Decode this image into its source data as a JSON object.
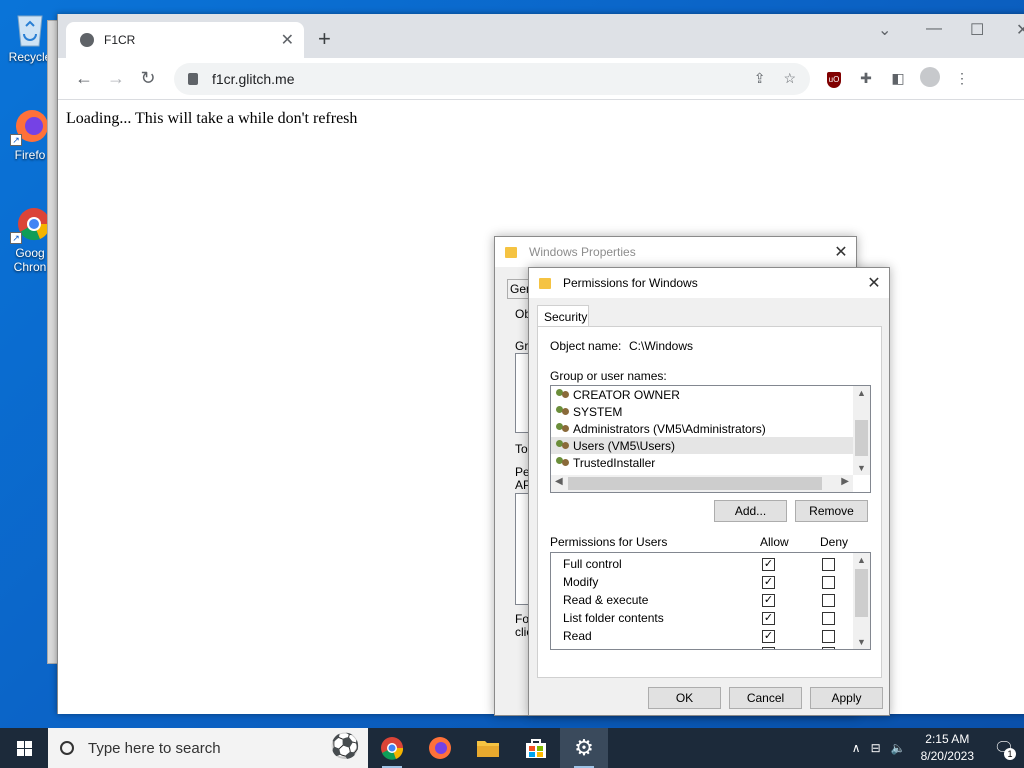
{
  "desktop": {
    "icons": [
      {
        "label": "Recycle",
        "icon": "recycle-bin-icon"
      },
      {
        "label": "Firefo",
        "icon": "firefox-icon"
      },
      {
        "label": "Goog",
        "label2": "Chron",
        "icon": "chrome-icon"
      }
    ]
  },
  "browser": {
    "tab_title": "F1CR",
    "url": "f1cr.glitch.me",
    "page_text": "Loading... This will take a while don't refresh"
  },
  "back_dialog": {
    "title": "Windows Properties",
    "fragments": [
      "Gen",
      "Ob",
      "Gr",
      "To",
      "Pe",
      "AP",
      "Fo",
      "clic"
    ]
  },
  "perm_dialog": {
    "title": "Permissions for Windows",
    "tab": "Security",
    "object_label": "Object name:",
    "object_value": "C:\\Windows",
    "group_label": "Group or user names:",
    "groups": [
      {
        "name": "CREATOR OWNER",
        "selected": false
      },
      {
        "name": "SYSTEM",
        "selected": false
      },
      {
        "name": "Administrators (VM5\\Administrators)",
        "selected": false
      },
      {
        "name": "Users (VM5\\Users)",
        "selected": true
      },
      {
        "name": "TrustedInstaller",
        "selected": false
      }
    ],
    "add_label": "Add...",
    "remove_label": "Remove",
    "perms_label": "Permissions for Users",
    "allow_label": "Allow",
    "deny_label": "Deny",
    "permissions": [
      {
        "name": "Full control",
        "allow": true,
        "deny": false
      },
      {
        "name": "Modify",
        "allow": true,
        "deny": false
      },
      {
        "name": "Read & execute",
        "allow": true,
        "deny": false
      },
      {
        "name": "List folder contents",
        "allow": true,
        "deny": false
      },
      {
        "name": "Read",
        "allow": true,
        "deny": false
      }
    ],
    "ok_label": "OK",
    "cancel_label": "Cancel",
    "apply_label": "Apply"
  },
  "taskbar": {
    "search_placeholder": "Type here to search",
    "time": "2:15 AM",
    "date": "8/20/2023",
    "notification_count": "1"
  }
}
